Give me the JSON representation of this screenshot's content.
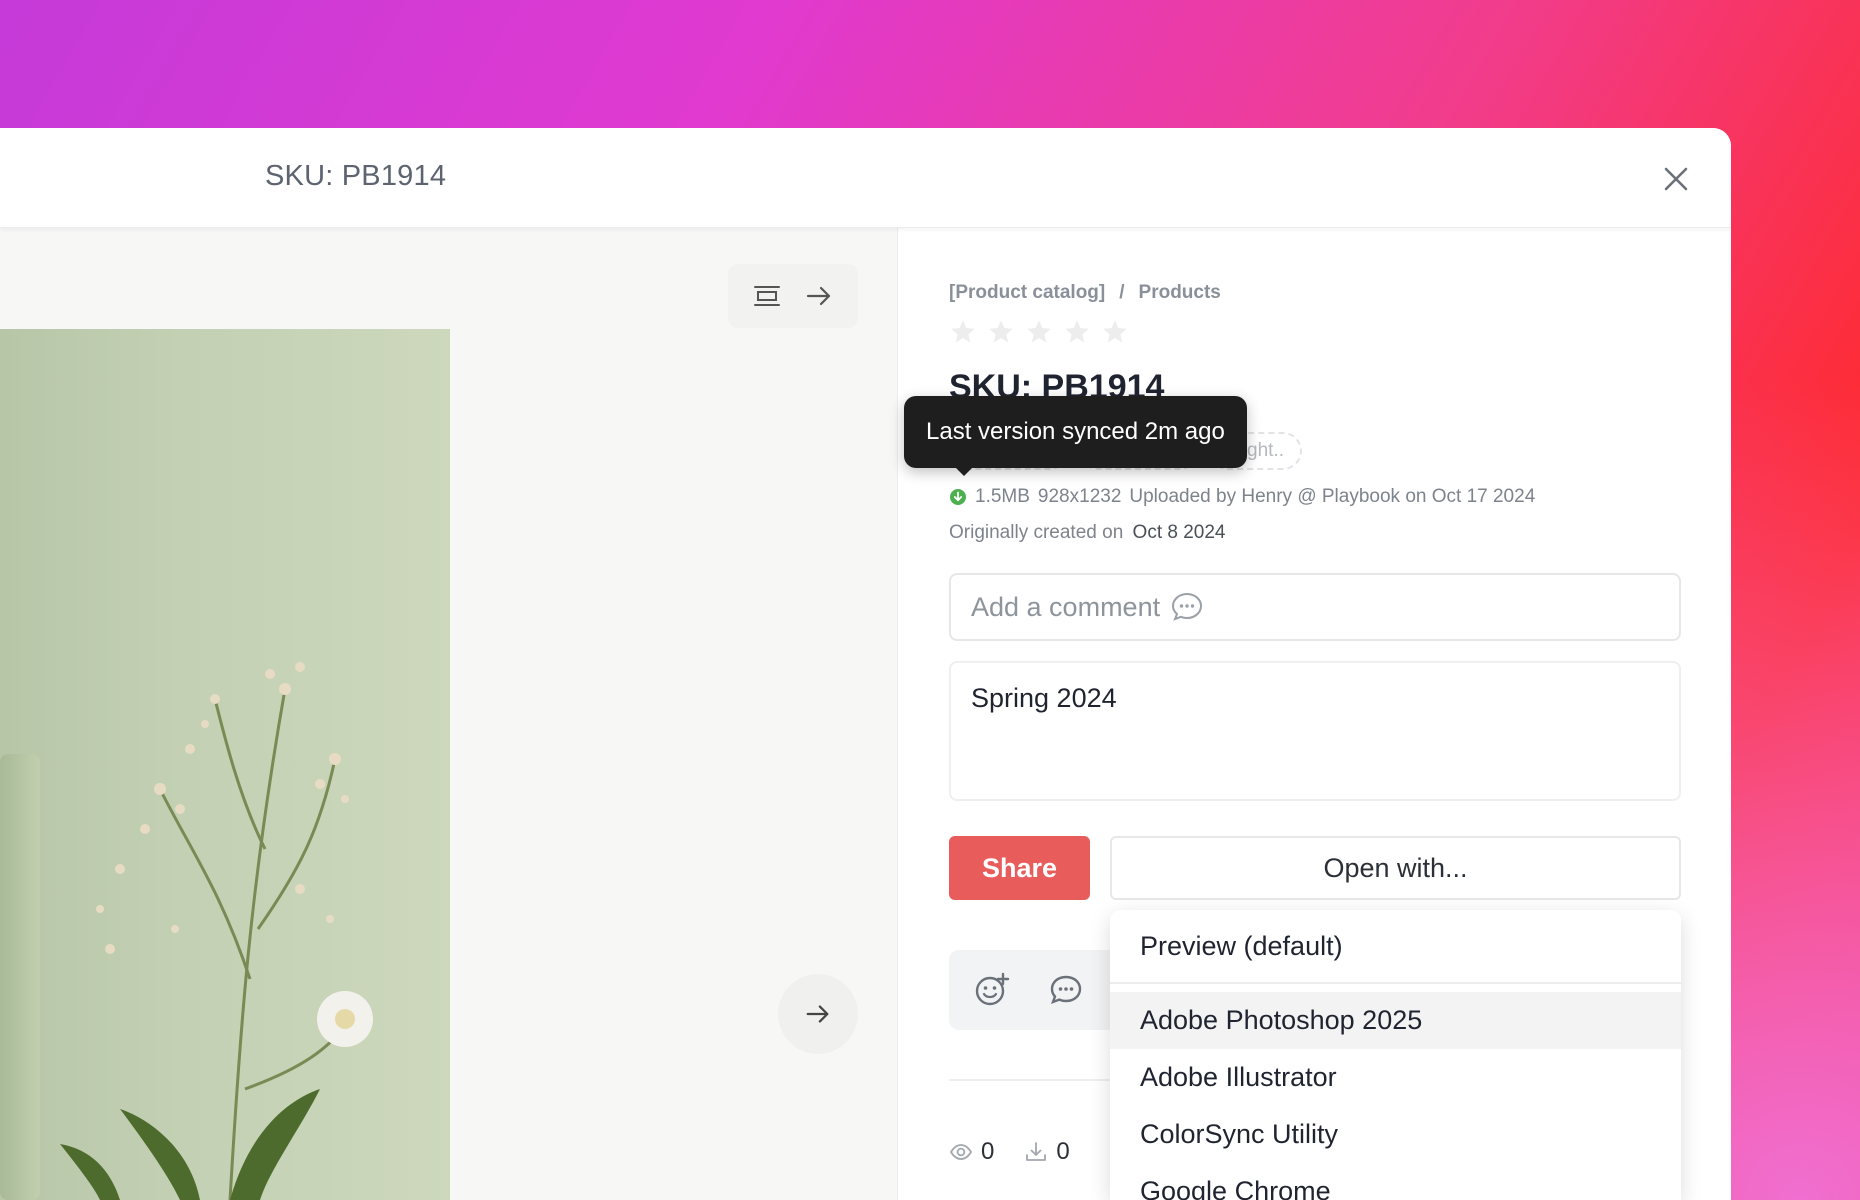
{
  "header": {
    "title": "SKU: PB1914"
  },
  "preview": {},
  "details": {
    "breadcrumb": [
      "[Product catalog]",
      "/",
      "Products"
    ],
    "rating": 0,
    "title": "SKU: PB1914",
    "tag_partial": "yright..",
    "tooltip": "Last version synced 2m ago",
    "meta": {
      "size": "1.5MB",
      "dimensions": "928x1232",
      "uploaded": "Uploaded by Henry @ Playbook on Oct 17 2024"
    },
    "created": {
      "label": "Originally created on",
      "date": "Oct 8 2024"
    },
    "comment": {
      "placeholder": "Add a comment"
    },
    "notes": "Spring 2024",
    "share_label": "Share",
    "open_with_label": "Open with...",
    "stats": {
      "views": "0",
      "downloads": "0"
    }
  },
  "open_with_menu": {
    "items": [
      "Preview (default)",
      "Adobe Photoshop 2025",
      "Adobe Illustrator",
      "ColorSync Utility",
      "Google Chrome"
    ],
    "highlighted": "Adobe Photoshop 2025"
  },
  "colors": {
    "accent": "#e85c5c",
    "sync_green": "#4caf50"
  }
}
